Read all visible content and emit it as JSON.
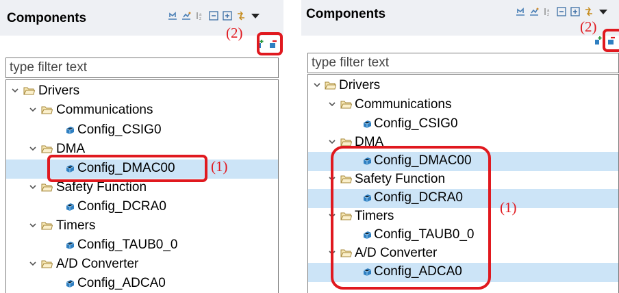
{
  "left": {
    "title": "Components",
    "filter_placeholder": "type filter text",
    "tree": [
      {
        "label": "Drivers"
      },
      {
        "label": "Communications"
      },
      {
        "label": "Config_CSIG0"
      },
      {
        "label": "DMA"
      },
      {
        "label": "Config_DMAC00"
      },
      {
        "label": "Safety Function"
      },
      {
        "label": "Config_DCRA0"
      },
      {
        "label": "Timers"
      },
      {
        "label": "Config_TAUB0_0"
      },
      {
        "label": "A/D Converter"
      },
      {
        "label": "Config_ADCA0"
      }
    ],
    "annotations": {
      "one": "(1)",
      "two": "(2)"
    }
  },
  "right": {
    "title": "Components",
    "filter_placeholder": "type filter text",
    "tree": [
      {
        "label": "Drivers"
      },
      {
        "label": "Communications"
      },
      {
        "label": "Config_CSIG0"
      },
      {
        "label": "DMA"
      },
      {
        "label": "Config_DMAC00"
      },
      {
        "label": "Safety Function"
      },
      {
        "label": "Config_DCRA0"
      },
      {
        "label": "Timers"
      },
      {
        "label": "Config_TAUB0_0"
      },
      {
        "label": "A/D Converter"
      },
      {
        "label": "Config_ADCA0"
      }
    ],
    "annotations": {
      "one": "(1)",
      "two": "(2)"
    }
  },
  "colors": {
    "highlight": "#e0191f",
    "selection": "#cce4f7",
    "header": "#eef0f4"
  },
  "icons": {
    "toolbar": [
      "expand-all-icon",
      "collapse-icon",
      "sort-icon",
      "collapse-all-icon",
      "expand-tree-icon",
      "link-icon",
      "view-menu-icon"
    ],
    "folder": "folder-icon",
    "component": "component-cube-icon",
    "add": "add-component-icon",
    "remove": "remove-component-icon"
  }
}
